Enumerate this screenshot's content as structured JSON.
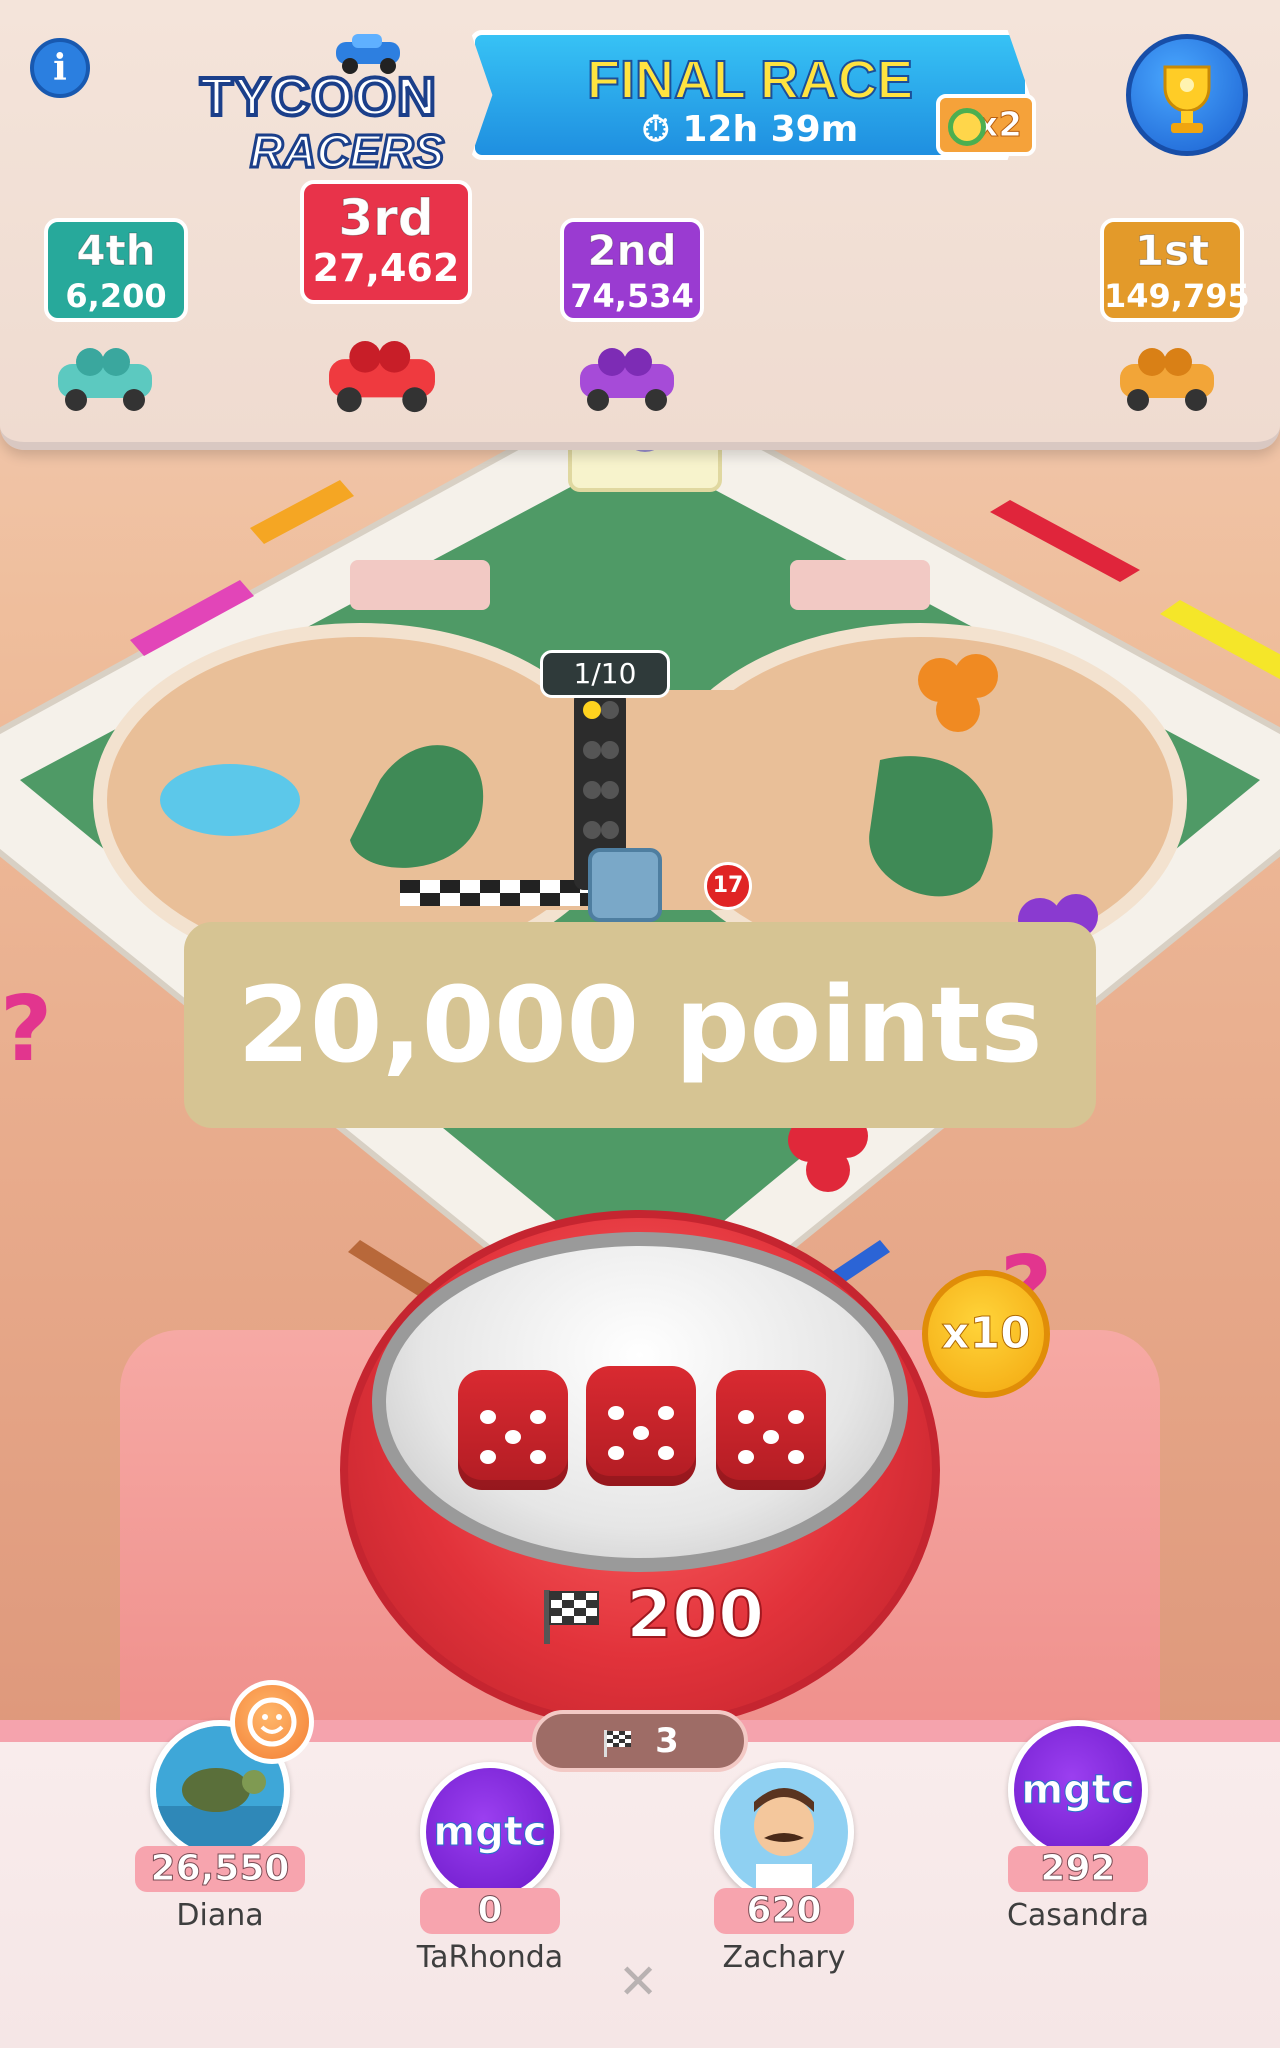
{
  "race": {
    "logo_line1": "TYCOON",
    "logo_line2": "RACERS",
    "title": "FINAL RACE",
    "timer": "12h 39m",
    "bonus_multiplier": "x2"
  },
  "standings": [
    {
      "position": "4th",
      "points": "6,200",
      "color": "#27a99b"
    },
    {
      "position": "3rd",
      "points": "27,462",
      "color": "#e8334a"
    },
    {
      "position": "2nd",
      "points": "74,534",
      "color": "#9a3bd1"
    },
    {
      "position": "1st",
      "points": "149,795",
      "color": "#e39a2a"
    }
  ],
  "board": {
    "lap_progress": "1/10",
    "notification_count": "17"
  },
  "banner": {
    "text": "20,000 points"
  },
  "dice": {
    "roll_cost": "200",
    "multiplier": "x10",
    "flags_count": "3"
  },
  "players": [
    {
      "name": "Diana",
      "score": "26,550",
      "avatar": "turtle"
    },
    {
      "name": "TaRhonda",
      "score": "0",
      "avatar": "mgtc"
    },
    {
      "name": "Zachary",
      "score": "620",
      "avatar": "mustache-man"
    },
    {
      "name": "Casandra",
      "score": "292",
      "avatar": "mgtc"
    }
  ],
  "avatar_logo_text": "mgtc",
  "icons": {
    "info": "info-icon",
    "trophy": "trophy-icon",
    "timer": "stopwatch-icon",
    "flag": "checkered-flag-icon",
    "emoji": "smiley-icon",
    "close": "close-icon"
  }
}
